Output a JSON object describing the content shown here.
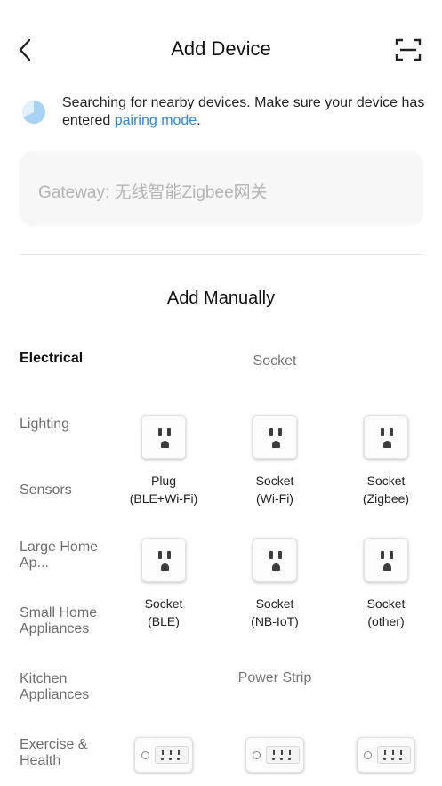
{
  "header": {
    "title": "Add Device",
    "back_icon": "chevron-left-icon",
    "scan_icon": "scan-icon"
  },
  "search": {
    "message": "Searching for nearby devices. Make sure your device has entered ",
    "link": "pairing mode",
    "suffix": "."
  },
  "gateway": {
    "label": "Gateway: 无线智能Zigbee网关"
  },
  "manual": {
    "title": "Add Manually"
  },
  "categories": [
    {
      "label": "Electrical",
      "active": true
    },
    {
      "label": "Lighting"
    },
    {
      "label": "Sensors"
    },
    {
      "label": "Large Home Ap..."
    },
    {
      "label": "Small Home Appliances"
    },
    {
      "label": "Kitchen Appliances"
    },
    {
      "label": "Exercise & Health"
    }
  ],
  "sections": [
    {
      "title": "Socket",
      "devices": [
        {
          "line1": "Plug",
          "line2": "(BLE+Wi-Fi)"
        },
        {
          "line1": "Socket",
          "line2": "(Wi-Fi)"
        },
        {
          "line1": "Socket",
          "line2": "(Zigbee)"
        },
        {
          "line1": "Socket",
          "line2": "(BLE)"
        },
        {
          "line1": "Socket",
          "line2": "(NB-IoT)"
        },
        {
          "line1": "Socket",
          "line2": "(other)"
        }
      ]
    },
    {
      "title": "Power Strip"
    }
  ],
  "colors": {
    "link": "#2a8ae0",
    "spinner": "#a9d3f5",
    "gateway_bg": "#f7f7f7"
  }
}
